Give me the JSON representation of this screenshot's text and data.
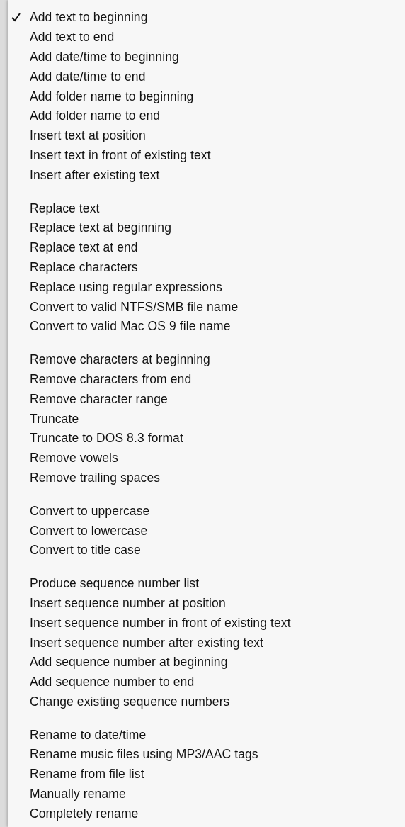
{
  "menu": {
    "groups": [
      {
        "items": [
          {
            "label": "Add text to beginning",
            "checked": true
          },
          {
            "label": "Add text to end",
            "checked": false
          },
          {
            "label": "Add date/time to beginning",
            "checked": false
          },
          {
            "label": "Add date/time to end",
            "checked": false
          },
          {
            "label": "Add folder name to beginning",
            "checked": false
          },
          {
            "label": "Add folder name to end",
            "checked": false
          },
          {
            "label": "Insert text at position",
            "checked": false
          },
          {
            "label": "Insert text in front of existing text",
            "checked": false
          },
          {
            "label": "Insert after existing text",
            "checked": false
          }
        ]
      },
      {
        "items": [
          {
            "label": "Replace text",
            "checked": false
          },
          {
            "label": "Replace text at beginning",
            "checked": false
          },
          {
            "label": "Replace text at end",
            "checked": false
          },
          {
            "label": "Replace characters",
            "checked": false
          },
          {
            "label": "Replace using regular expressions",
            "checked": false
          },
          {
            "label": "Convert to valid NTFS/SMB file name",
            "checked": false
          },
          {
            "label": "Convert to valid Mac OS 9 file name",
            "checked": false
          }
        ]
      },
      {
        "items": [
          {
            "label": "Remove characters at beginning",
            "checked": false
          },
          {
            "label": "Remove characters from end",
            "checked": false
          },
          {
            "label": "Remove character range",
            "checked": false
          },
          {
            "label": "Truncate",
            "checked": false
          },
          {
            "label": "Truncate to DOS 8.3 format",
            "checked": false
          },
          {
            "label": "Remove vowels",
            "checked": false
          },
          {
            "label": "Remove trailing spaces",
            "checked": false
          }
        ]
      },
      {
        "items": [
          {
            "label": "Convert to uppercase",
            "checked": false
          },
          {
            "label": "Convert to lowercase",
            "checked": false
          },
          {
            "label": "Convert to title case",
            "checked": false
          }
        ]
      },
      {
        "items": [
          {
            "label": "Produce sequence number list",
            "checked": false
          },
          {
            "label": "Insert sequence number at position",
            "checked": false
          },
          {
            "label": "Insert sequence number in front of existing text",
            "checked": false
          },
          {
            "label": "Insert sequence number after existing text",
            "checked": false
          },
          {
            "label": "Add sequence number at beginning",
            "checked": false
          },
          {
            "label": "Add sequence number to end",
            "checked": false
          },
          {
            "label": "Change existing sequence numbers",
            "checked": false
          }
        ]
      },
      {
        "items": [
          {
            "label": "Rename to date/time",
            "checked": false
          },
          {
            "label": "Rename music files using MP3/AAC tags",
            "checked": false
          },
          {
            "label": "Rename from file list",
            "checked": false
          },
          {
            "label": "Manually rename",
            "checked": false
          },
          {
            "label": "Completely rename",
            "checked": false
          }
        ]
      }
    ]
  }
}
